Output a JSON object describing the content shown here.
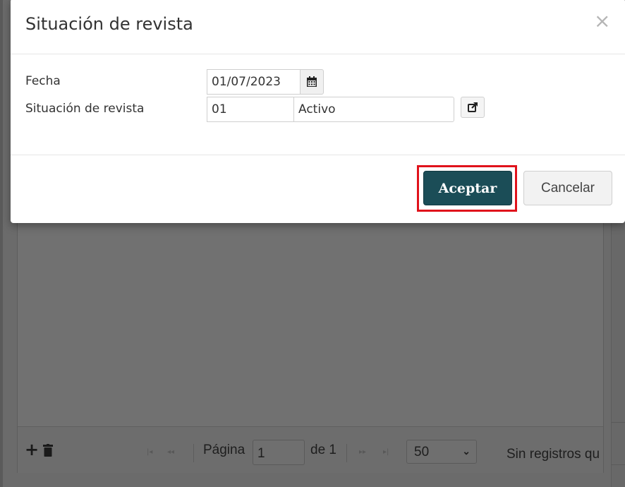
{
  "modal": {
    "title": "Situación de revista",
    "close_glyph": "×",
    "fields": {
      "fecha_label": "Fecha",
      "fecha_value": "01/07/2023",
      "situacion_label": "Situación de revista",
      "situacion_code": "01",
      "situacion_desc": "Activo"
    },
    "buttons": {
      "accept": "Aceptar",
      "cancel": "Cancelar"
    },
    "highlight_color": "#e0121b",
    "accept_color": "#1b4d57"
  },
  "pager": {
    "page_label": "Página",
    "page_value": "1",
    "of_label": "de 1",
    "page_size": "50",
    "info_text": "Sin registros qu"
  },
  "icons": [
    "calendar-icon",
    "external-link-icon",
    "close-icon",
    "add-icon",
    "trash-icon",
    "chevron-down-icon"
  ]
}
